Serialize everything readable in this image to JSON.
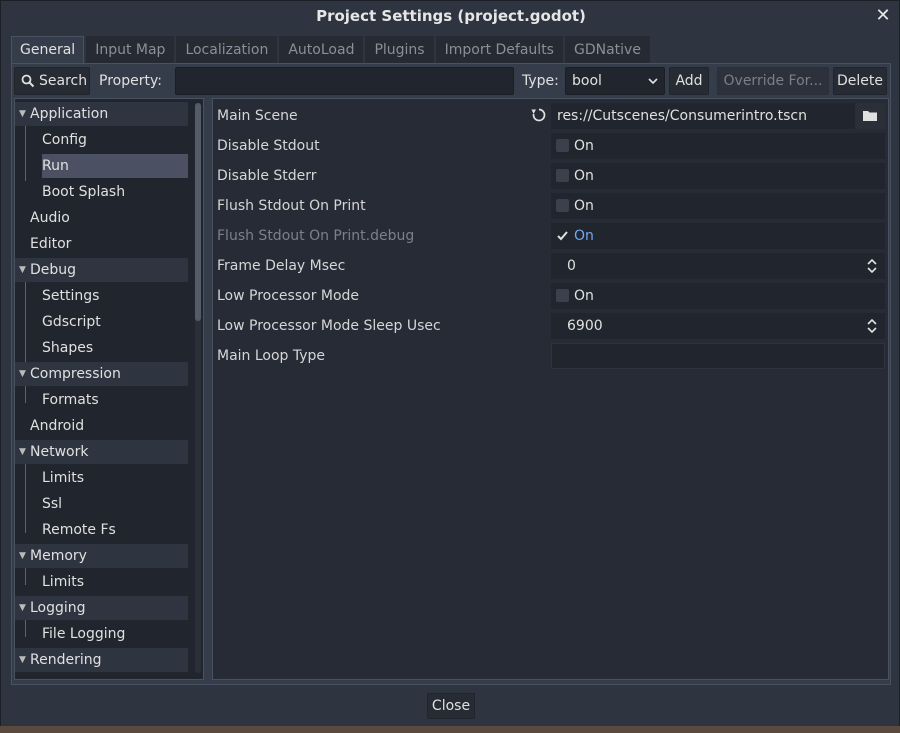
{
  "window": {
    "title": "Project Settings (project.godot)"
  },
  "tabs": [
    {
      "label": "General",
      "active": true
    },
    {
      "label": "Input Map"
    },
    {
      "label": "Localization"
    },
    {
      "label": "AutoLoad"
    },
    {
      "label": "Plugins"
    },
    {
      "label": "Import Defaults"
    },
    {
      "label": "GDNative"
    }
  ],
  "toolbar": {
    "search_label": "Search",
    "property_label": "Property:",
    "property_value": "",
    "type_label": "Type:",
    "type_value": "bool",
    "add_label": "Add",
    "override_label": "Override For...",
    "delete_label": "Delete"
  },
  "tree": [
    {
      "label": "Application",
      "level": 0,
      "section": true
    },
    {
      "label": "Config",
      "level": 1
    },
    {
      "label": "Run",
      "level": 1,
      "selected": true
    },
    {
      "label": "Boot Splash",
      "level": 1
    },
    {
      "label": "Audio",
      "level": 0
    },
    {
      "label": "Editor",
      "level": 0
    },
    {
      "label": "Debug",
      "level": 0,
      "section": true
    },
    {
      "label": "Settings",
      "level": 1
    },
    {
      "label": "Gdscript",
      "level": 1
    },
    {
      "label": "Shapes",
      "level": 1
    },
    {
      "label": "Compression",
      "level": 0,
      "section": true
    },
    {
      "label": "Formats",
      "level": 1
    },
    {
      "label": "Android",
      "level": 0
    },
    {
      "label": "Network",
      "level": 0,
      "section": true
    },
    {
      "label": "Limits",
      "level": 1
    },
    {
      "label": "Ssl",
      "level": 1
    },
    {
      "label": "Remote Fs",
      "level": 1
    },
    {
      "label": "Memory",
      "level": 0,
      "section": true
    },
    {
      "label": "Limits",
      "level": 1
    },
    {
      "label": "Logging",
      "level": 0,
      "section": true
    },
    {
      "label": "File Logging",
      "level": 1
    },
    {
      "label": "Rendering",
      "level": 0,
      "section": true
    }
  ],
  "properties": [
    {
      "name": "Main Scene",
      "kind": "path",
      "value": "res://Cutscenes/Consumerintro.tscn"
    },
    {
      "name": "Disable Stdout",
      "kind": "bool",
      "checked": false,
      "value": "On"
    },
    {
      "name": "Disable Stderr",
      "kind": "bool",
      "checked": false,
      "value": "On"
    },
    {
      "name": "Flush Stdout On Print",
      "kind": "bool",
      "checked": false,
      "value": "On"
    },
    {
      "name": "Flush Stdout On Print.debug",
      "kind": "bool",
      "checked": true,
      "dim": true,
      "value": "On"
    },
    {
      "name": "Frame Delay Msec",
      "kind": "number",
      "value": "0"
    },
    {
      "name": "Low Processor Mode",
      "kind": "bool",
      "checked": false,
      "value": "On"
    },
    {
      "name": "Low Processor Mode Sleep Usec",
      "kind": "number",
      "value": "6900"
    },
    {
      "name": "Main Loop Type",
      "kind": "text",
      "value": ""
    }
  ],
  "footer": {
    "close_label": "Close"
  },
  "colors": {
    "accent_on": "#70a8f0",
    "selected_row": "#4b5162",
    "background": "#2f3441"
  }
}
